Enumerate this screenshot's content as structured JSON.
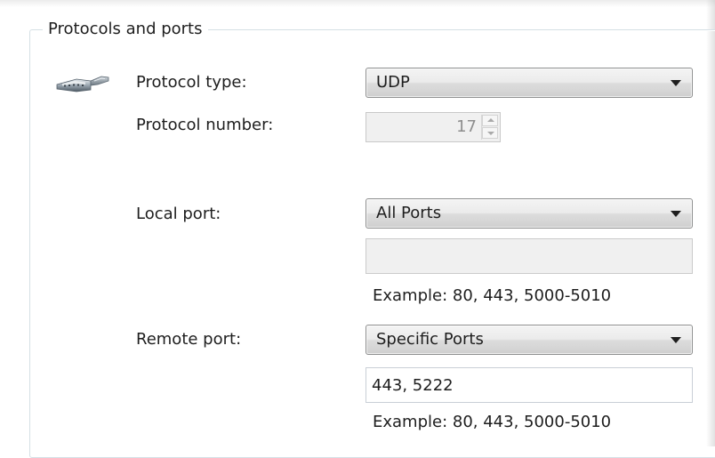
{
  "group": {
    "title": "Protocols and ports"
  },
  "protocol": {
    "type_label": "Protocol type:",
    "type_value": "UDP",
    "number_label": "Protocol number:",
    "number_value": "17"
  },
  "local_port": {
    "label": "Local port:",
    "selected": "All Ports",
    "value": "",
    "example": "Example: 80, 443, 5000-5010"
  },
  "remote_port": {
    "label": "Remote port:",
    "selected": "Specific Ports",
    "value": "443, 5222",
    "example": "Example: 80, 443, 5000-5010"
  },
  "icons": {
    "protocol": "network-plug-icon",
    "dropdown": "chevron-down-icon"
  }
}
